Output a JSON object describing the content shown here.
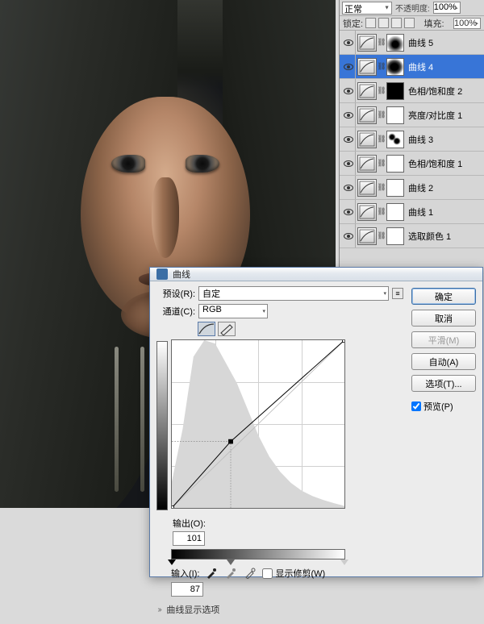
{
  "layers_header": {
    "blend_mode": "正常",
    "opacity_label": "不透明度:",
    "opacity_value": "100%",
    "lock_label": "锁定:",
    "fill_label": "填充:",
    "fill_value": "100%"
  },
  "layers": [
    {
      "name": "曲线 5",
      "mask": "soft1",
      "selected": false
    },
    {
      "name": "曲线 4",
      "mask": "soft2",
      "selected": true
    },
    {
      "name": "色相/饱和度 2",
      "mask": "black",
      "selected": false
    },
    {
      "name": "亮度/对比度 1",
      "mask": "white",
      "selected": false
    },
    {
      "name": "曲线 3",
      "mask": "brush",
      "selected": false
    },
    {
      "name": "色相/饱和度 1",
      "mask": "white",
      "selected": false
    },
    {
      "name": "曲线 2",
      "mask": "white",
      "selected": false
    },
    {
      "name": "曲线 1",
      "mask": "white",
      "selected": false
    },
    {
      "name": "选取颜色 1",
      "mask": "white",
      "selected": false
    }
  ],
  "curves": {
    "title": "曲线",
    "preset_label": "预设(R):",
    "preset_value": "自定",
    "channel_label": "通道(C):",
    "channel_value": "RGB",
    "output_label": "输出(O):",
    "output_value": "101",
    "input_label": "输入(I):",
    "input_value": "87",
    "clip_label": "显示修剪(W)",
    "expand_label": "曲线显示选项",
    "buttons": {
      "ok": "确定",
      "cancel": "取消",
      "smooth": "平滑(M)",
      "auto": "自动(A)",
      "options": "选项(T)...",
      "preview": "预览(P)"
    }
  },
  "chart_data": {
    "type": "line",
    "title": "曲线",
    "xlabel": "输入",
    "ylabel": "输出",
    "xlim": [
      0,
      255
    ],
    "ylim": [
      0,
      255
    ],
    "series": [
      {
        "name": "基线",
        "x": [
          0,
          255
        ],
        "y": [
          0,
          255
        ]
      },
      {
        "name": "曲线",
        "x": [
          0,
          87,
          255
        ],
        "y": [
          0,
          101,
          255
        ]
      }
    ],
    "selected_point": {
      "input": 87,
      "output": 101
    },
    "histogram": {
      "x": [
        0,
        16,
        32,
        48,
        64,
        80,
        96,
        112,
        128,
        144,
        160,
        176,
        192,
        208,
        224,
        240,
        255
      ],
      "y": [
        40,
        120,
        230,
        255,
        250,
        220,
        190,
        150,
        110,
        78,
        55,
        38,
        26,
        18,
        12,
        7,
        3
      ]
    }
  }
}
